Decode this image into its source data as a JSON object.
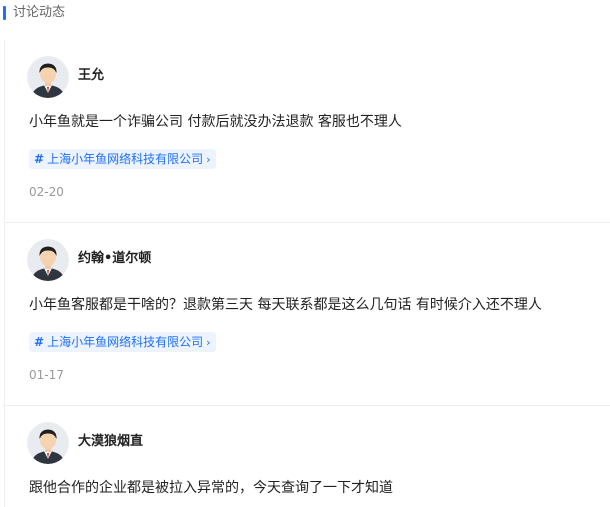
{
  "section": {
    "title": "讨论动态",
    "accent_color": "#1e6fff"
  },
  "posts": [
    {
      "author": "王允",
      "content": "小年鱼就是一个诈骗公司 付款后就没办法退款 客服也不理人",
      "tag": "上海小年鱼网络科技有限公司",
      "date": "02-20"
    },
    {
      "author": "约翰•道尔顿",
      "content": "小年鱼客服都是干啥的？退款第三天 每天联系都是这么几句话 有时候介入还不理人",
      "tag": "上海小年鱼网络科技有限公司",
      "date": "01-17"
    },
    {
      "author": "大漠狼烟直",
      "content": "跟他合作的企业都是被拉入异常的，今天查询了一下才知道"
    }
  ],
  "icons": {
    "avatar": "default-user-avatar-icon",
    "tag_prefix": "hashtag-icon",
    "tag_suffix": "chevron-right-icon"
  }
}
